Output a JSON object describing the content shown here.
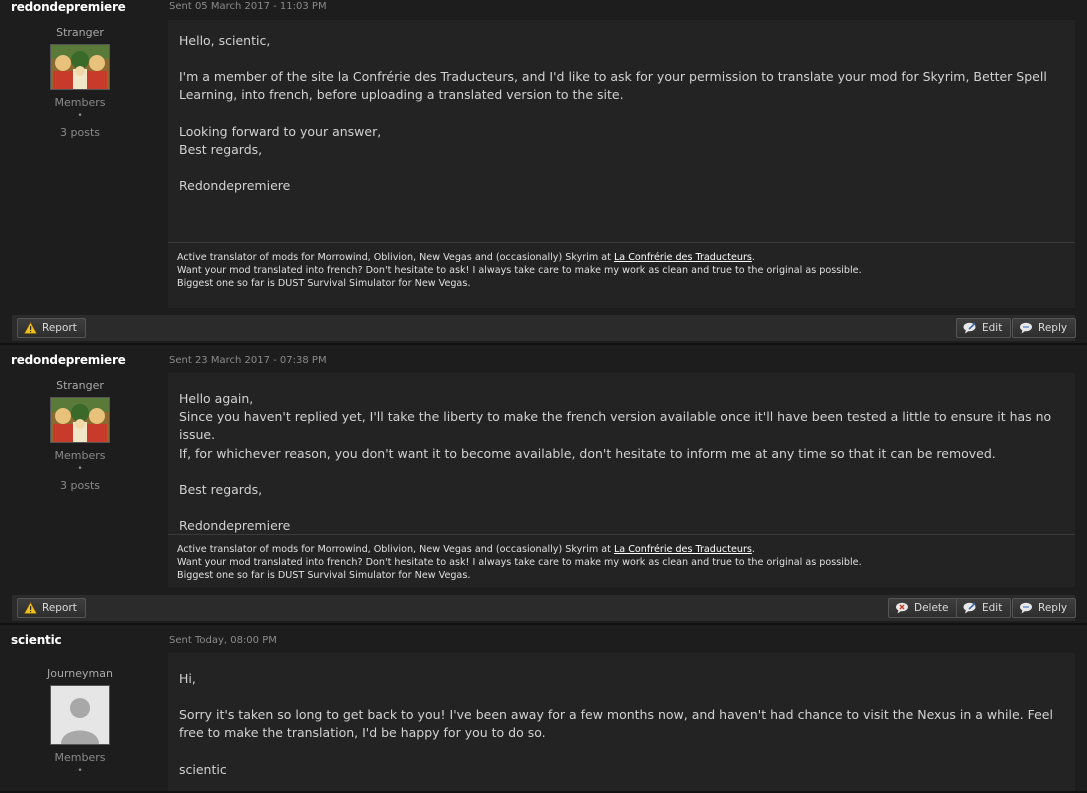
{
  "messages": [
    {
      "author": "redondepremiere",
      "sent": "Sent 05 March 2017 - 11:03 PM",
      "rank": "Stranger",
      "group": "Members",
      "dot": "•",
      "posts": "3 posts",
      "body": [
        "Hello, scientic,",
        "I'm a member of the site la Confrérie des Traducteurs, and I'd like to ask for your permission to translate your mod for Skyrim, Better Spell Learning, into french, before uploading a translated version to the site.",
        "Looking forward to your answer,",
        "Best regards,",
        "Redondepremiere"
      ],
      "signature": {
        "line1_before": "Active translator of mods for Morrowind, Oblivion, New Vegas and (occasionally) Skyrim at ",
        "link": "La Confrérie des Traducteurs",
        "line1_after": ".",
        "line2": "Want your mod translated into french? Don't hesitate to ask! I always take care to make my work as clean and true to the original as possible.",
        "line3": "Biggest one so far is DUST Survival Simulator for New Vegas."
      },
      "buttons": {
        "report": "Report",
        "edit": "Edit",
        "reply": "Reply"
      }
    },
    {
      "author": "redondepremiere",
      "sent": "Sent 23 March 2017 - 07:38 PM",
      "rank": "Stranger",
      "group": "Members",
      "dot": "•",
      "posts": "3 posts",
      "body": [
        "Hello again,",
        "Since you haven't replied yet, I'll take the liberty to make the french version available once it'll have been tested a little to ensure it has no issue.",
        "If, for whichever reason, you don't want it to become available, don't hesitate to inform me at any time so that it can be removed.",
        "Best regards,",
        "Redondepremiere"
      ],
      "signature": {
        "line1_before": "Active translator of mods for Morrowind, Oblivion, New Vegas and (occasionally) Skyrim at ",
        "link": "La Confrérie des Traducteurs",
        "line1_after": ".",
        "line2": "Want your mod translated into french? Don't hesitate to ask! I always take care to make my work as clean and true to the original as possible.",
        "line3": "Biggest one so far is DUST Survival Simulator for New Vegas."
      },
      "buttons": {
        "report": "Report",
        "delete": "Delete",
        "edit": "Edit",
        "reply": "Reply"
      }
    },
    {
      "author": "scientic",
      "sent": "Sent Today, 08:00 PM",
      "rank": "Journeyman",
      "group": "Members",
      "dot": "•",
      "body": [
        "Hi,",
        "Sorry it's taken so long to get back to you! I've been away for a few months now, and haven't had chance to visit the Nexus in a while. Feel free to make the translation, I'd be happy for you to do so.",
        "scientic"
      ]
    }
  ]
}
